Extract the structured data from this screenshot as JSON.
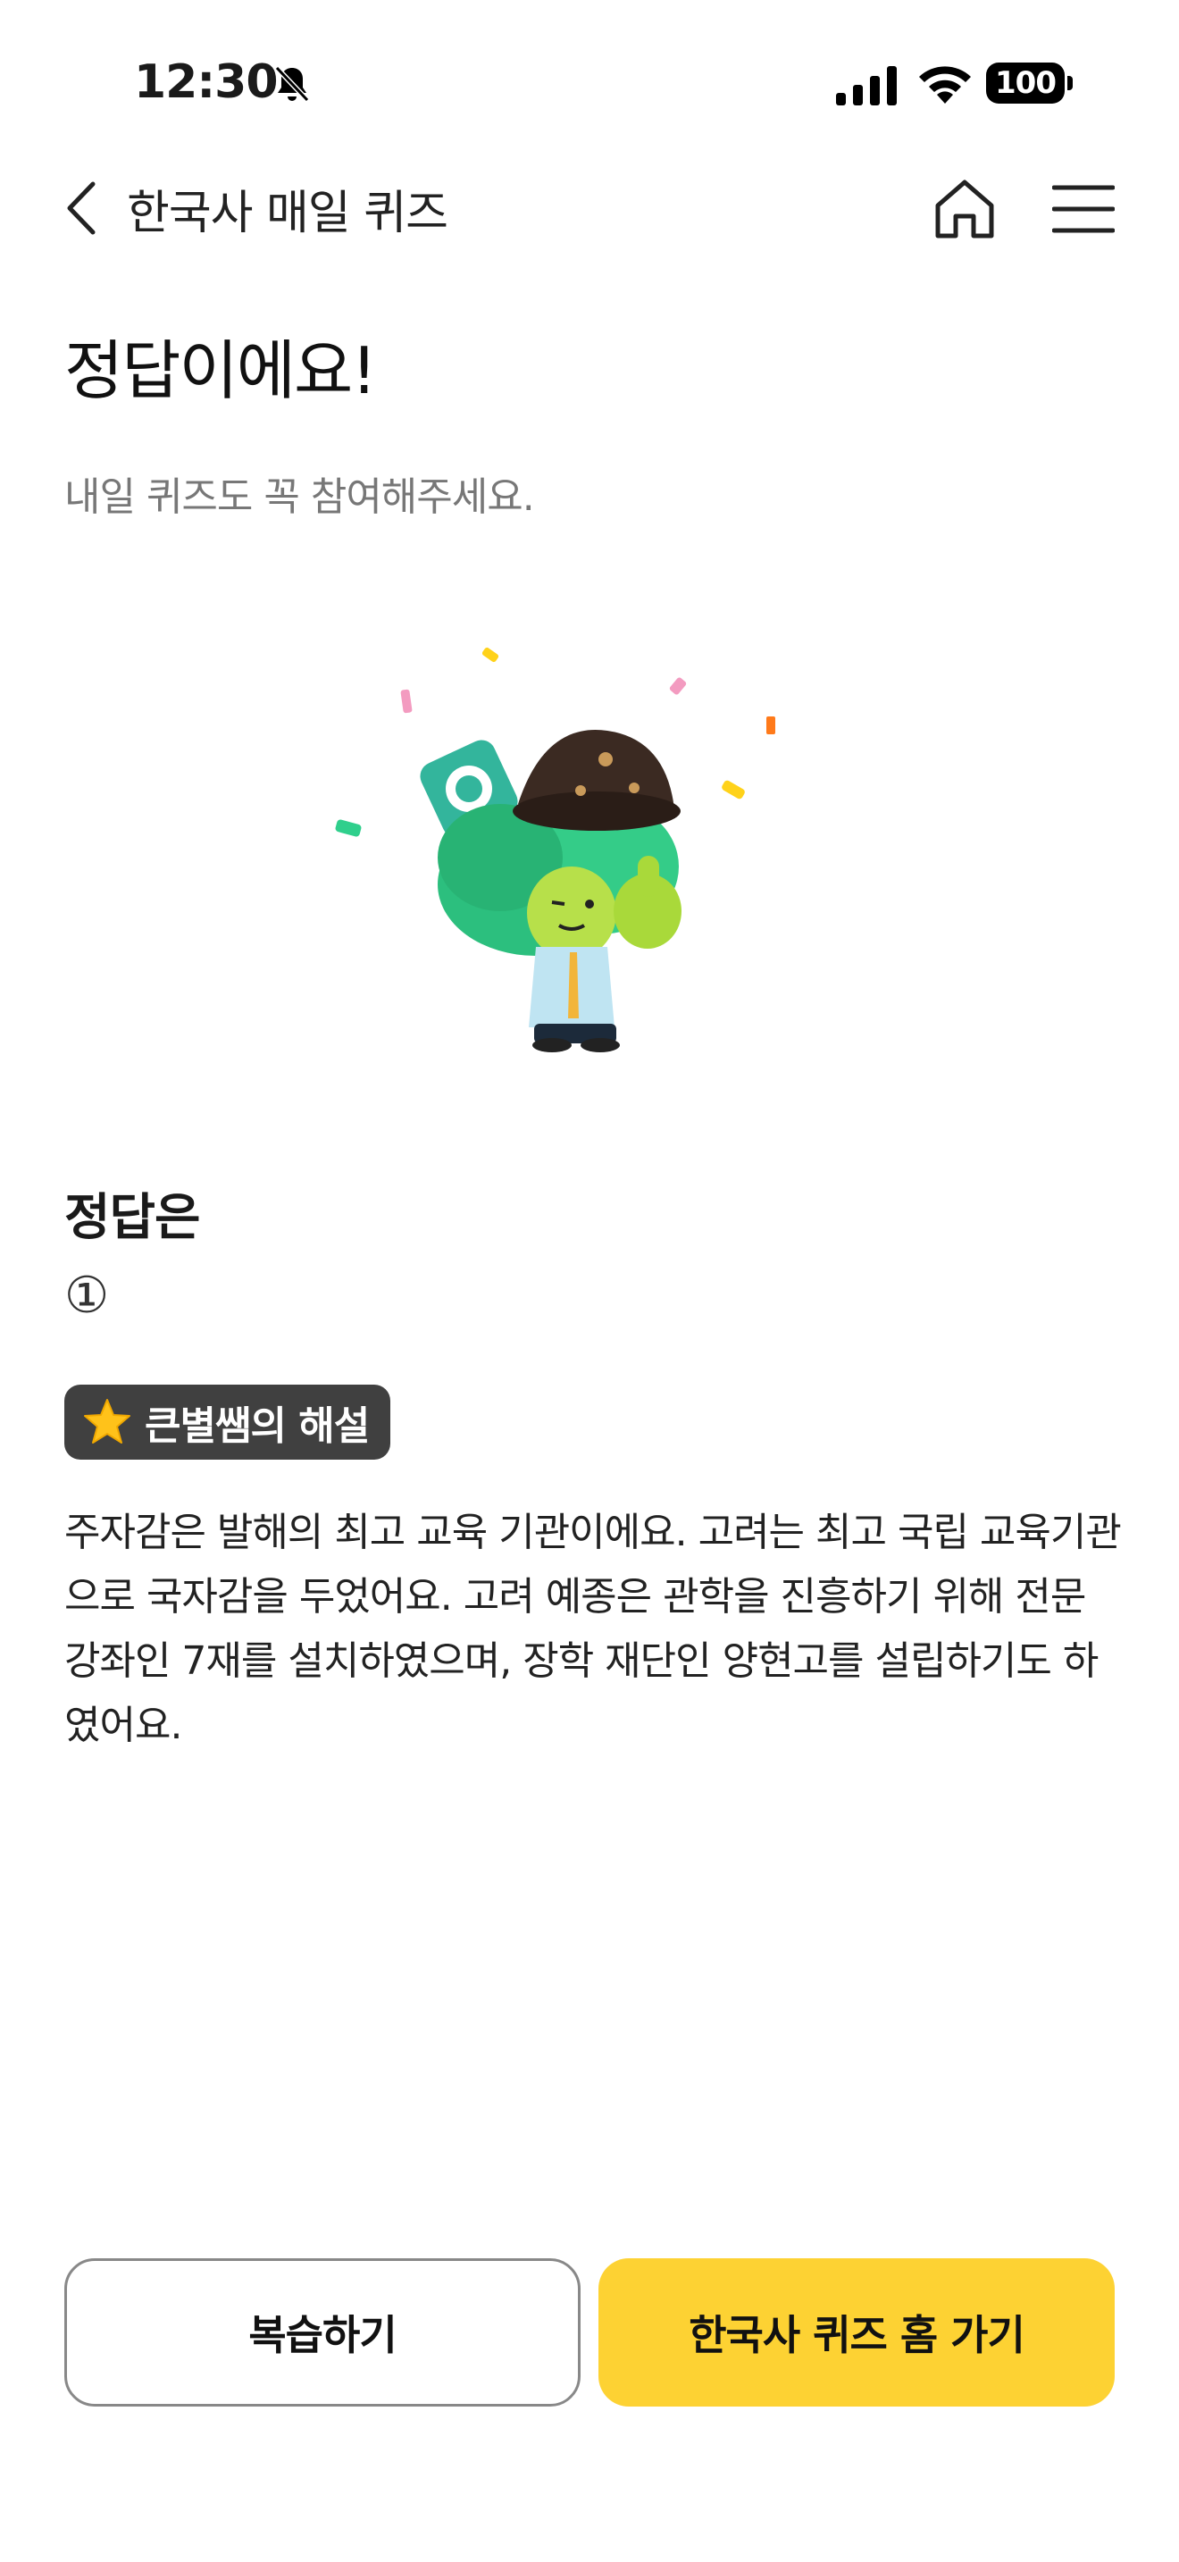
{
  "status_bar": {
    "time": "12:30",
    "battery": "100"
  },
  "nav": {
    "title": "한국사 매일 퀴즈"
  },
  "result": {
    "headline": "정답이에요!",
    "subline": "내일 퀴즈도 꼭 참여해주세요."
  },
  "answer": {
    "heading": "정답은",
    "value": "①"
  },
  "explanation_badge": {
    "label": "큰별쌤의 해설"
  },
  "explanation": {
    "text": "주자감은 발해의 최고 교육 기관이에요. 고려는 최고 국립 교육기관으로 국자감을 두었어요. 고려 예종은 관학을 진흥하기 위해 전문 강좌인 7재를 설치하였으며, 장학 재단인 양현고를 설립하기도 하였어요."
  },
  "buttons": {
    "review": "복습하기",
    "quiz_home": "한국사 퀴즈 홈 가기"
  },
  "colors": {
    "accent": "#fdd233",
    "badge_bg": "#404040",
    "subtext": "#777777"
  },
  "icons": {
    "back": "chevron-left-icon",
    "home": "home-icon",
    "menu": "hamburger-menu-icon",
    "bell_muted": "bell-slash-icon",
    "signal": "cellular-signal-icon",
    "wifi": "wifi-icon",
    "star": "star-icon"
  }
}
